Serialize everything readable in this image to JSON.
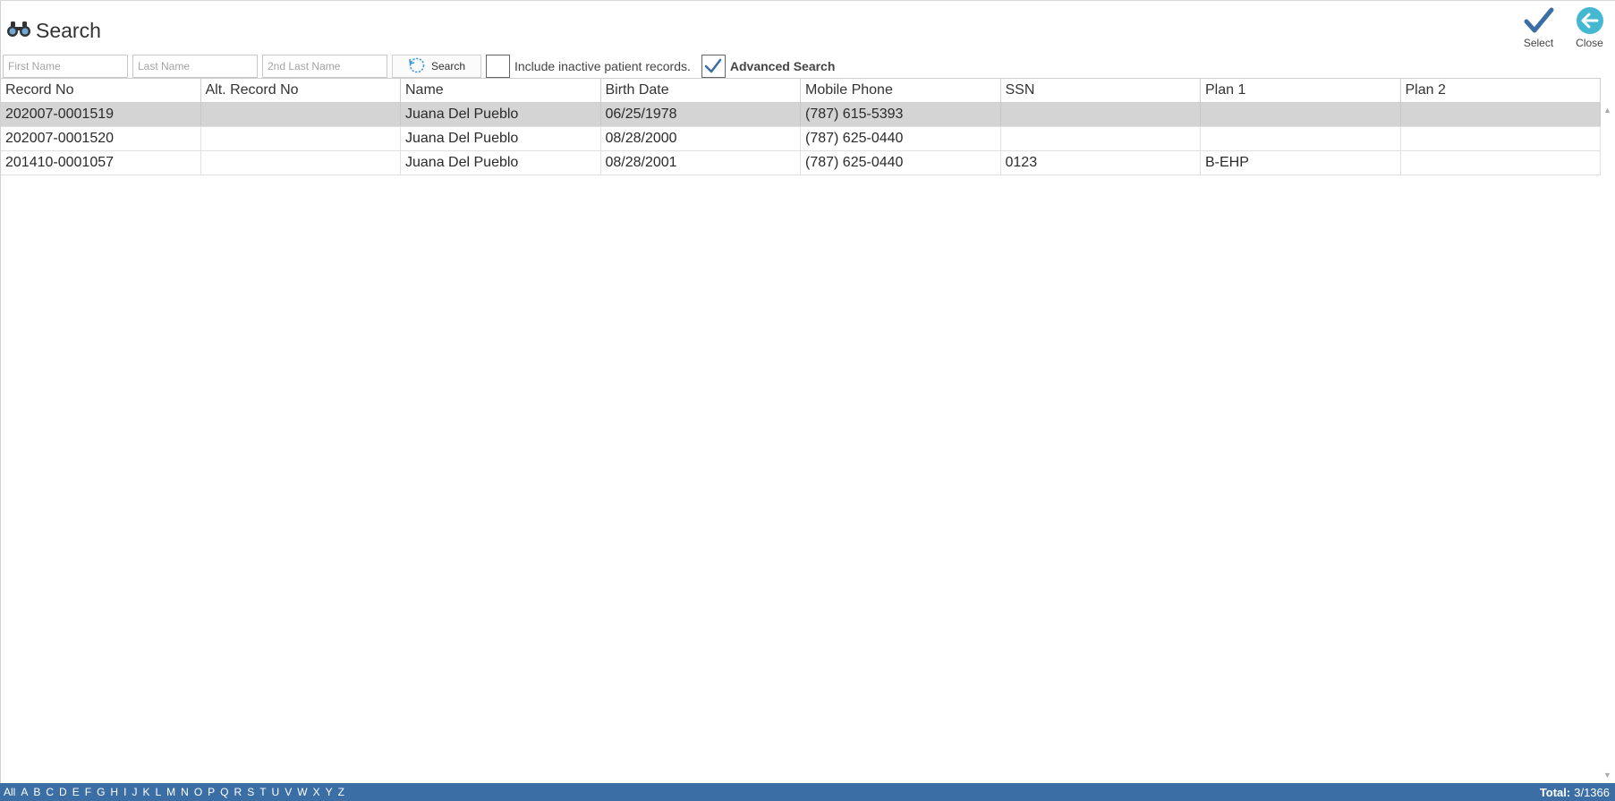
{
  "header": {
    "title": "Search",
    "title_icon": "binoculars-icon"
  },
  "actions": {
    "select": {
      "label": "Select",
      "icon": "checkmark-icon",
      "color": "#3b6ea5"
    },
    "close": {
      "label": "Close",
      "icon": "arrow-left-circle-icon",
      "color": "#45b8d1"
    }
  },
  "filters": {
    "first_name_placeholder": "First Name",
    "last_name_placeholder": "Last Name",
    "second_last_name_placeholder": "2nd Last Name",
    "search_button": "Search",
    "include_inactive_label": "Include inactive patient records.",
    "include_inactive_checked": false,
    "advanced_search_label": "Advanced Search",
    "advanced_search_checked": true
  },
  "grid": {
    "columns": [
      "Record No",
      "Alt. Record No",
      "Name",
      "Birth Date",
      "Mobile Phone",
      "SSN",
      "Plan 1",
      "Plan 2"
    ],
    "rows": [
      {
        "selected": true,
        "cells": [
          "202007-0001519",
          "",
          "Juana Del Pueblo",
          "06/25/1978",
          "(787) 615-5393",
          "",
          "",
          ""
        ]
      },
      {
        "selected": false,
        "cells": [
          "202007-0001520",
          "",
          "Juana Del Pueblo",
          "08/28/2000",
          "(787) 625-0440",
          "",
          "",
          ""
        ]
      },
      {
        "selected": false,
        "cells": [
          "201410-0001057",
          "",
          "Juana Del Pueblo",
          "08/28/2001",
          "(787) 625-0440",
          "0123",
          "B-EHP",
          ""
        ]
      }
    ]
  },
  "footer": {
    "letters": [
      "All",
      "A",
      "B",
      "C",
      "D",
      "E",
      "F",
      "G",
      "H",
      "I",
      "J",
      "K",
      "L",
      "M",
      "N",
      "O",
      "P",
      "Q",
      "R",
      "S",
      "T",
      "U",
      "V",
      "W",
      "X",
      "Y",
      "Z"
    ],
    "total_label": "Total:",
    "total_value": "3/1366",
    "bar_color": "#3b6ea5"
  }
}
